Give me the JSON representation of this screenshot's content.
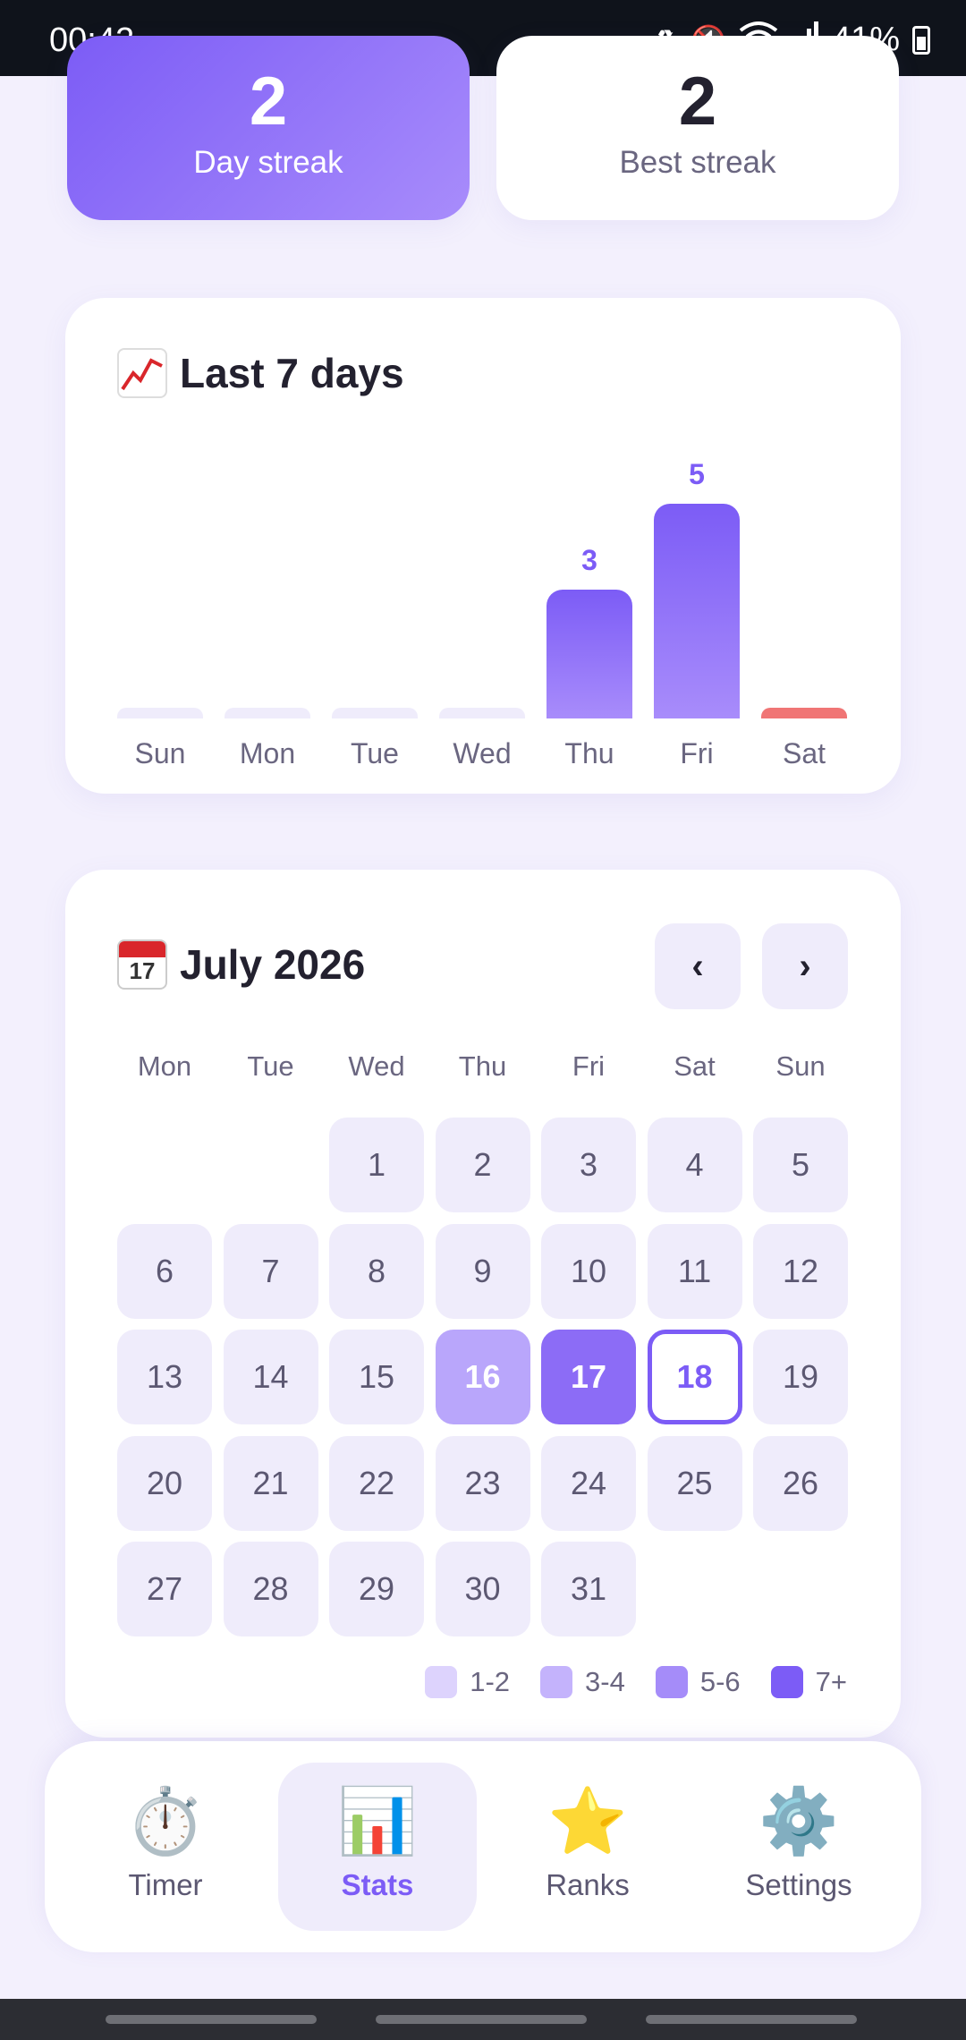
{
  "status_bar": {
    "time": "00:42",
    "battery": "41%",
    "icons": [
      "battery-saver-icon",
      "mute-icon",
      "wifi-icon",
      "signal-icon",
      "battery-icon"
    ]
  },
  "streaks": {
    "current": {
      "value": "2",
      "label": "Day streak"
    },
    "best": {
      "value": "2",
      "label": "Best streak"
    }
  },
  "week": {
    "title": "Last 7 days",
    "icon": "chart-increasing-icon",
    "accent": "#7c5cf6",
    "today_color": "#f07575"
  },
  "chart_data": {
    "type": "bar",
    "categories": [
      "Sun",
      "Mon",
      "Tue",
      "Wed",
      "Thu",
      "Fri",
      "Sat"
    ],
    "values": [
      0,
      0,
      0,
      0,
      3,
      5,
      0
    ],
    "data_labels": [
      "",
      "",
      "",
      "",
      "3",
      "5",
      ""
    ],
    "highlight_category": "Sat",
    "ylim": [
      0,
      5
    ],
    "grid": false
  },
  "calendar": {
    "title": "July 2026",
    "icon": "calendar-icon",
    "prev_label": "‹",
    "next_label": "›",
    "weekdays": [
      "Mon",
      "Tue",
      "Wed",
      "Thu",
      "Fri",
      "Sat",
      "Sun"
    ],
    "first_weekday_index": 2,
    "days_in_month": 31,
    "levels": {
      "16": 2,
      "17": 3
    },
    "today": 18,
    "legend": [
      {
        "label": "1-2",
        "color": "#ddd3fd"
      },
      {
        "label": "3-4",
        "color": "#c4b3fc"
      },
      {
        "label": "5-6",
        "color": "#a58cf9"
      },
      {
        "label": "7+",
        "color": "#7c5cf6"
      }
    ]
  },
  "bottom_nav": {
    "items": [
      {
        "label": "Timer",
        "icon": "stopwatch-icon",
        "glyph": "⏱️",
        "active": false
      },
      {
        "label": "Stats",
        "icon": "bar-chart-icon",
        "glyph": "📊",
        "active": true
      },
      {
        "label": "Ranks",
        "icon": "star-icon",
        "glyph": "⭐",
        "active": false
      },
      {
        "label": "Settings",
        "icon": "gear-icon",
        "glyph": "⚙️",
        "active": false
      }
    ]
  }
}
